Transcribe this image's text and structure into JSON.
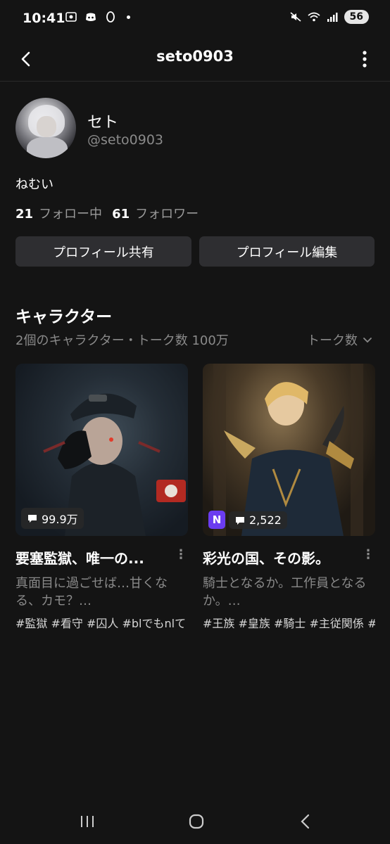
{
  "status_bar": {
    "time": "10:41",
    "battery": "56",
    "icons": [
      "screenshot-icon",
      "discord-icon",
      "ring-icon",
      "dot-icon",
      "mute-icon",
      "wifi-icon",
      "signal-icon"
    ]
  },
  "header": {
    "title": "seto0903",
    "back_icon": "back-arrow-icon",
    "more_icon": "more-vertical-icon"
  },
  "profile": {
    "name": "セト",
    "handle": "@seto0903",
    "bio": "ねむい",
    "following_count": "21",
    "following_label": "フォロー中",
    "followers_count": "61",
    "followers_label": "フォロワー",
    "share_button": "プロフィール共有",
    "edit_button": "プロフィール編集"
  },
  "characters": {
    "title": "キャラクター",
    "subtitle": "2個のキャラクター・トーク数 100万",
    "sort_label": "トーク数",
    "items": [
      {
        "title": "要塞監獄、唯一の...",
        "description": "真面目に過ごせば…甘くなる、カモ？…",
        "tags": "#監獄 #看守 #囚人 #blでもnlて",
        "talk_count": "99.9万"
      },
      {
        "title": "彩光の国、その影。",
        "description": "騎士となるか。工作員となるか。…",
        "tags": "#王族 #皇族 #騎士 #主従関係 #",
        "talk_count": "2,522",
        "badge": "N"
      }
    ]
  },
  "colors": {
    "background": "#141414",
    "button": "#2e2e31",
    "muted_text": "#8a8a8a",
    "badge_purple": "#6b3cf0"
  }
}
